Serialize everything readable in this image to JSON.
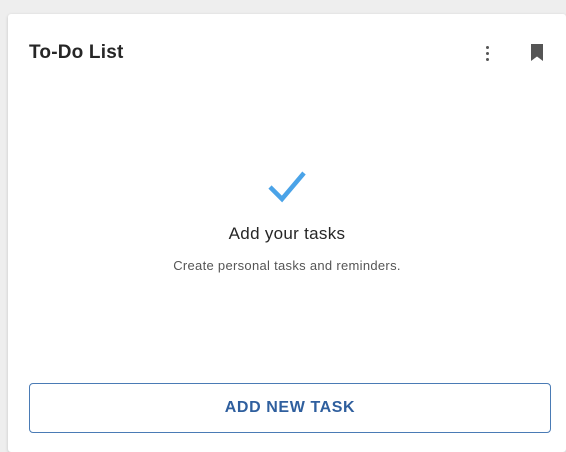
{
  "card": {
    "title": "To-Do List",
    "more_icon": "more-vertical-icon",
    "bookmark_icon": "bookmark-icon"
  },
  "empty_state": {
    "icon": "checkmark-icon",
    "heading": "Add your tasks",
    "subtext": "Create personal tasks and reminders."
  },
  "actions": {
    "add_task_label": "ADD NEW TASK"
  },
  "colors": {
    "accent_check": "#4aa3e8",
    "button_border": "#4a7bb5",
    "button_text": "#2f5f9e"
  }
}
